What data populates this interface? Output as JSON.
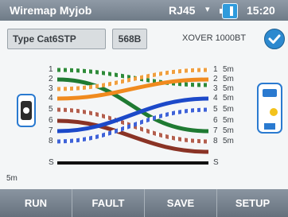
{
  "titlebar": {
    "app_title": "Wiremap  Myjob",
    "port": "RJ45",
    "port_arrow": "▾",
    "time": "15:20"
  },
  "info": {
    "cable_type": "Type Cat6STP",
    "standard": "568B",
    "result": "XOVER 1000BT"
  },
  "wiremap": {
    "left_pins": [
      "1",
      "2",
      "3",
      "4",
      "5",
      "6",
      "7",
      "8",
      "S"
    ],
    "right_pins": [
      "1",
      "2",
      "3",
      "4",
      "5",
      "6",
      "7",
      "8",
      "S"
    ],
    "right_lengths": [
      "5m",
      "5m",
      "5m",
      "5m",
      "5m",
      "5m",
      "5m",
      "5m"
    ],
    "shield_length": "5m",
    "wire_colors": {
      "green_stripe": "#2e8b3a",
      "green": "#1f7a32",
      "orange_stripe": "#f0a040",
      "orange": "#f08a1e",
      "blue": "#1c49c9",
      "blue_stripe": "#3f63d8",
      "brown_stripe": "#b35f4e",
      "brown": "#8a3325",
      "shield": "#111111"
    }
  },
  "softkeys": {
    "run": "RUN",
    "fault": "FAULT",
    "save": "SAVE",
    "setup": "SETUP"
  }
}
